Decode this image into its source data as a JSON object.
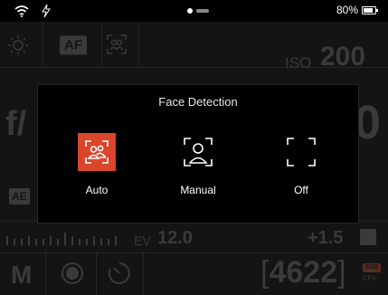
{
  "status_bar": {
    "battery_percent": "80%",
    "wifi_icon": "wifi-icon",
    "flash_icon": "lightning-icon",
    "page_indicator": {
      "count": 2,
      "active": 0
    }
  },
  "background": {
    "af_label": "AF",
    "iso_label": "ISO",
    "iso_value": "200",
    "aperture_label": "f/",
    "aperture_value_partial": "0",
    "ae_label": "AE",
    "ev_label": "EV",
    "ev_value": "12.0",
    "exposure_comp": "+1.5",
    "mode": "M",
    "shots_remaining": "4622",
    "storage_badge": "SSD",
    "storage_type": "CFe"
  },
  "dialog": {
    "title": "Face Detection",
    "options": [
      {
        "label": "Auto",
        "icon": "face-detect-auto-icon",
        "selected": true
      },
      {
        "label": "Manual",
        "icon": "face-detect-manual-icon",
        "selected": false
      },
      {
        "label": "Off",
        "icon": "face-detect-off-icon",
        "selected": false
      }
    ],
    "accent_color": "#d9462c"
  }
}
